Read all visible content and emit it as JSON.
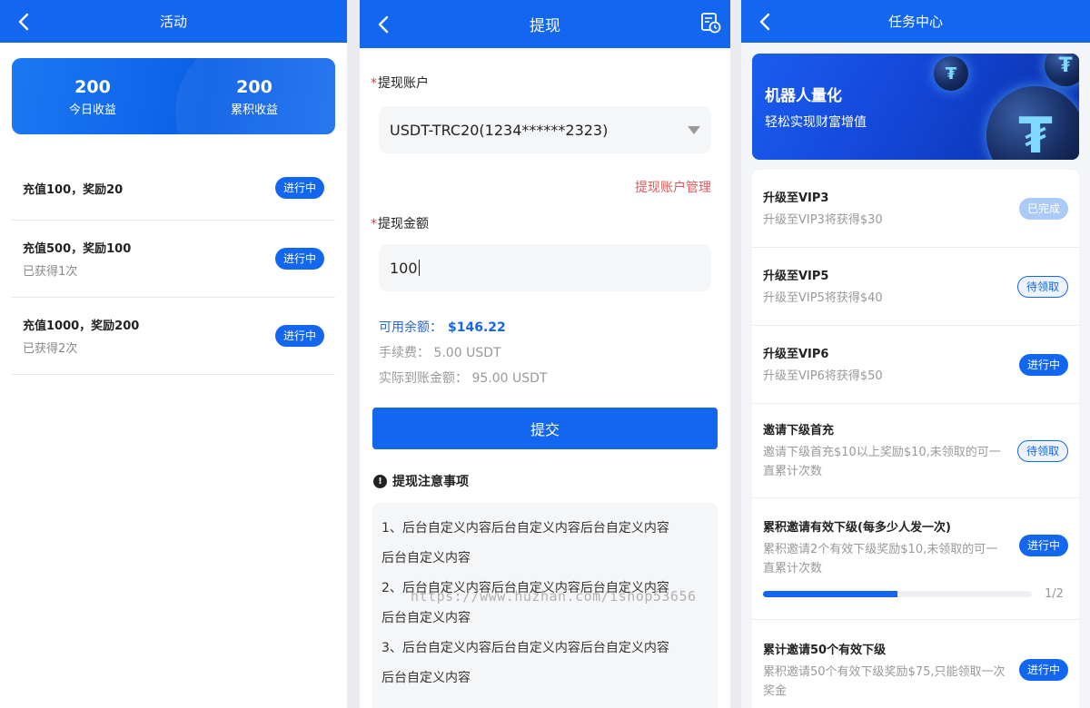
{
  "screen1": {
    "title": "活动",
    "summary": [
      {
        "value": "200",
        "label": "今日收益"
      },
      {
        "value": "200",
        "label": "累积收益"
      }
    ],
    "activities": [
      {
        "title": "充值100，奖励20",
        "sub": "",
        "status": "进行中"
      },
      {
        "title": "充值500，奖励100",
        "sub": "已获得1次",
        "status": "进行中"
      },
      {
        "title": "充值1000，奖励200",
        "sub": "已获得2次",
        "status": "进行中"
      }
    ]
  },
  "screen2": {
    "title": "提现",
    "account_label": "提现账户",
    "account_value": "USDT-TRC20(1234******2323)",
    "manage_link": "提现账户管理",
    "amount_label": "提现金额",
    "amount_value": "100",
    "available_label": "可用余额：",
    "available_value": "$146.22",
    "fee_text": "手续费：  5.00 USDT",
    "actual_text": "实际到账金额：  95.00 USDT",
    "submit_label": "提交",
    "notes_title": "提现注意事项",
    "notes": [
      "1、后台自定义内容后台自定义内容后台自定义内容",
      "后台自定义内容",
      "2、后台自定义内容后台自定义内容后台自定义内容",
      "后台自定义内容",
      "3、后台自定义内容后台自定义内容后台自定义内容",
      "后台自定义内容"
    ],
    "watermark": "https://www.huzhan.com/ishop53656"
  },
  "screen3": {
    "title": "任务中心",
    "banner_title": "机器人量化",
    "banner_sub": "轻松实现财富增值",
    "tasks": [
      {
        "title": "升级至VIP3",
        "desc": "升级至VIP3将获得$30",
        "status": "已完成",
        "style": "done"
      },
      {
        "title": "升级至VIP5",
        "desc": "升级至VIP5将获得$40",
        "status": "待领取",
        "style": "outline"
      },
      {
        "title": "升级至VIP6",
        "desc": "升级至VIP6将获得$50",
        "status": "进行中",
        "style": "blue"
      },
      {
        "title": "邀请下级首充",
        "desc": "邀请下级首充$10以上奖励$10,未领取的可一直累计次数",
        "status": "待领取",
        "style": "outline"
      },
      {
        "title": "累积邀请有效下级(每多少人发一次)",
        "desc": "累积邀请2个有效下级奖励$10,未领取的可一直累计次数",
        "status": "进行中",
        "style": "blue",
        "progress": 0.5,
        "progress_text": "1/2"
      },
      {
        "title": "累计邀请50个有效下级",
        "desc": "累积邀请50个有效下级奖励$75,只能领取一次奖金",
        "status": "进行中",
        "style": "blue"
      }
    ]
  }
}
